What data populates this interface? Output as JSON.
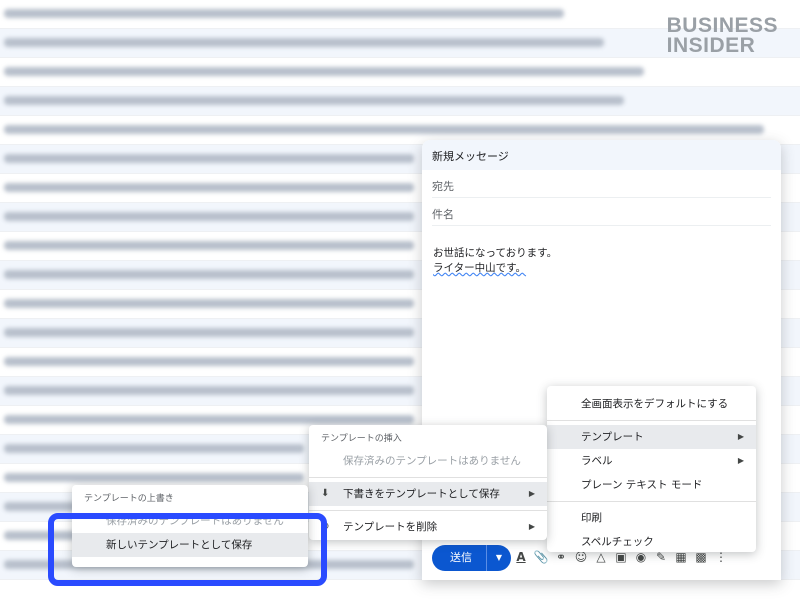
{
  "watermark": {
    "line1": "BUSINESS",
    "line2": "INSIDER"
  },
  "compose": {
    "title": "新規メッセージ",
    "to_label": "宛先",
    "subject_label": "件名",
    "body_line1": "お世話になっております。",
    "body_line2": "ライター中山です。",
    "send_label": "送信"
  },
  "toolbar_icons": [
    "text-format-icon",
    "attach-icon",
    "link-icon",
    "emoji-icon",
    "drive-icon",
    "photo-icon",
    "lock-icon",
    "pen-icon",
    "layout-icon",
    "calendar-icon",
    "more-options-icon"
  ],
  "more_menu": {
    "items": [
      "全画面表示をデフォルトにする",
      "テンプレート",
      "ラベル",
      "プレーン テキスト モード",
      "印刷",
      "スペルチェック"
    ]
  },
  "template_menu": {
    "insert_heading": "テンプレートの挿入",
    "no_saved": "保存済みのテンプレートはありません",
    "save_draft": "下書きをテンプレートとして保存",
    "delete": "テンプレートを削除"
  },
  "overwrite_menu": {
    "heading": "テンプレートの上書き",
    "no_saved": "保存済みのテンプレートはありません",
    "save_new": "新しいテンプレートとして保存"
  }
}
